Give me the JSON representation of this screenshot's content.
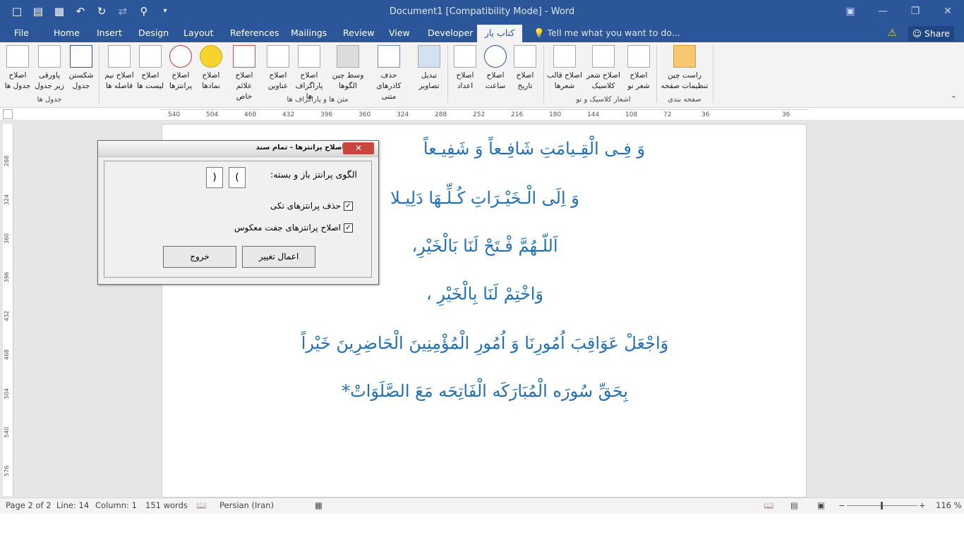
{
  "window": {
    "title": "Document1 [Compatibility Mode] - Word"
  },
  "tabs": [
    {
      "label": "File"
    },
    {
      "label": "Home"
    },
    {
      "label": "Insert"
    },
    {
      "label": "Design"
    },
    {
      "label": "Layout"
    },
    {
      "label": "References"
    },
    {
      "label": "Mailings"
    },
    {
      "label": "Review"
    },
    {
      "label": "View"
    },
    {
      "label": "Developer"
    },
    {
      "label": "کتاب یار"
    }
  ],
  "tell_me": "Tell me what you want to do...",
  "share": "Share",
  "ribbon": {
    "groups": [
      {
        "label": "جدول ها"
      },
      {
        "label": "متن ها و پاراگراف ها"
      },
      {
        "label": "اشعار کلاسیک و نو"
      },
      {
        "label": "صفحه بندی"
      }
    ],
    "buttons": [
      {
        "label": "اصلاح جدول ها"
      },
      {
        "label": "پاورقی زیر جدول"
      },
      {
        "label": "شکستن جدول"
      },
      {
        "label": "اصلاح نیم فاصله ها"
      },
      {
        "label": "اصلاح لیست ها"
      },
      {
        "label": "اصلاح پرانتزها"
      },
      {
        "label": "اصلاح نمادها"
      },
      {
        "label": "اصلاح علائم خاص"
      },
      {
        "label": "اصلاح عناوین"
      },
      {
        "label": "اصلاح پاراگراف ها"
      },
      {
        "label": "وسط چین الگوها"
      },
      {
        "label": "حذف کادرهای متنی"
      },
      {
        "label": "تبدیل تصاویر"
      },
      {
        "label": "اصلاح اعداد"
      },
      {
        "label": "اصلاح ساعت"
      },
      {
        "label": "اصلاح تاریخ"
      },
      {
        "label": "اصلاح قالب شعرها"
      },
      {
        "label": "اصلاح شعر کلاسیک"
      },
      {
        "label": "اصلاح شعر نو"
      },
      {
        "label": "راست چین تنظیمات صفحه"
      }
    ]
  },
  "ruler": [
    "540",
    "504",
    "468",
    "432",
    "396",
    "360",
    "324",
    "288",
    "252",
    "216",
    "180",
    "144",
    "108",
    "72",
    "36",
    "36"
  ],
  "vruler": [
    "288",
    "324",
    "360",
    "396",
    "432",
    "468",
    "504",
    "540",
    "576"
  ],
  "document": {
    "lines": [
      "وَ فِـی الْقِـیامَتِ شَافِـعاً وَ شَفِیـعاً",
      "وَ اِلَی الْـخَیْـرَاتِ کُـلِّـهَا دَلِیـلا",
      "اَللّـهُمَّ فْـتَحْ لَنَا بَالْخَیْرِ،",
      "وَاخْتِمْ لَنَا بِالْخَیْرِ ،",
      "وَاجْعَلْ عَوَاقِبَ اُمُورِنَا وَ اُمُورِ الْمُؤْمِنِینَ الْحَاضِرِینَ خَیْراً",
      "بِحَقِّ سُورَه الْمُبَارَکَه الْفَاتِحَه مَعَ الصَّلَوَاتْ*"
    ]
  },
  "dialog": {
    "title": "اصلاح پرانتزها - تمام سند",
    "close": "✕",
    "pattern_label": "الگوی پرانتز باز و بسته:",
    "open_paren": "(",
    "close_paren": ")",
    "checkbox1_label": "حذف پرانتزهای تکی",
    "checkbox2_label": "اصلاح پرانتزهای جفت معکوس",
    "checkbox1_checked": true,
    "checkbox2_checked": true,
    "apply_button": "اعمال تغییر",
    "exit_button": "خروج"
  },
  "status": {
    "page": "Page 2 of 2",
    "line": "Line: 14",
    "column": "Column: 1",
    "words": "151 words",
    "language": "Persian (Iran)",
    "zoom": "116 %"
  }
}
